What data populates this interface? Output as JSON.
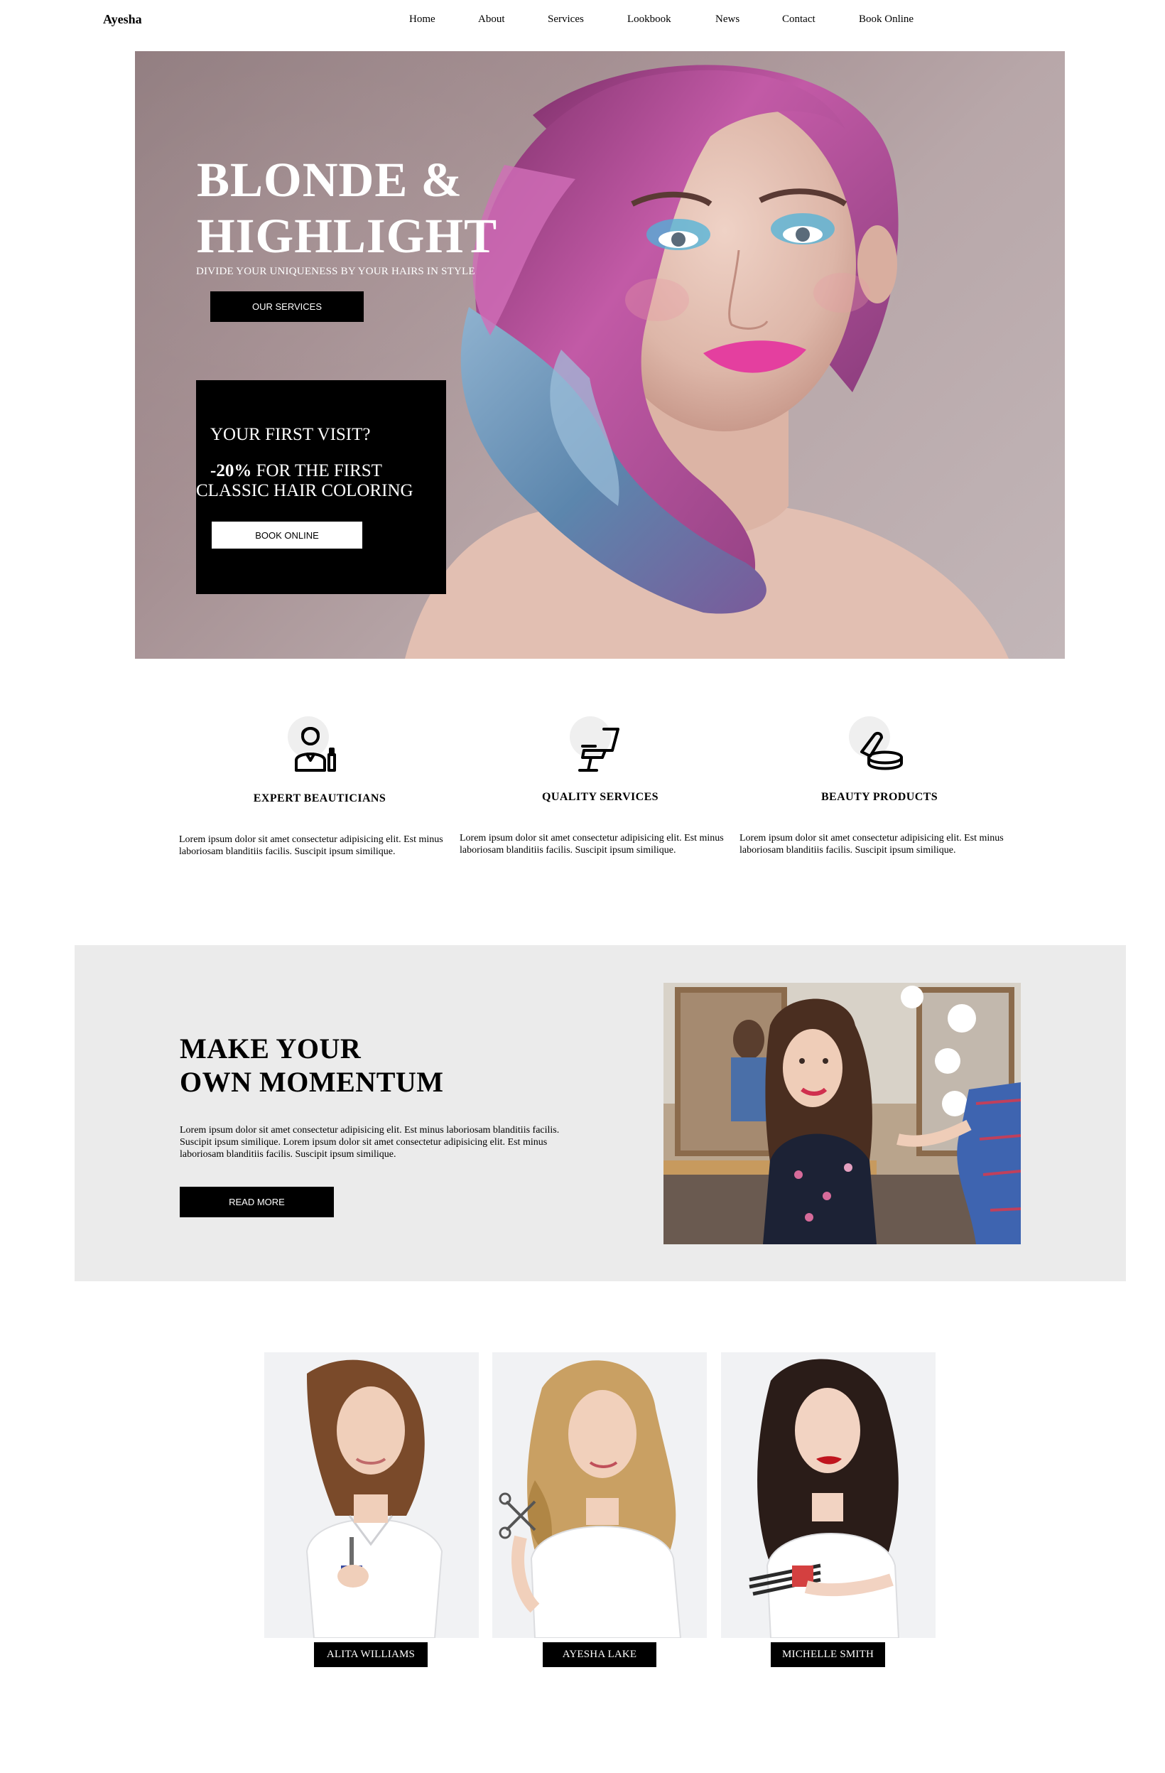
{
  "header": {
    "logo": "Ayesha",
    "nav": [
      "Home",
      "About",
      "Services",
      "Lookbook",
      "News",
      "Contact",
      "Book Online"
    ]
  },
  "hero": {
    "title_line1": "BLONDE &",
    "title_line2": "HIGHLIGHT",
    "subtitle": "DIVIDE YOUR UNIQUENESS BY YOUR HAIRS IN STYLE",
    "cta": "OUR SERVICES",
    "promo": {
      "question": "YOUR FIRST VISIT?",
      "discount": "-20%",
      "line1_rest": " FOR THE FIRST",
      "line2": "CLASSIC HAIR COLORING",
      "cta": "BOOK ONLINE"
    }
  },
  "features": [
    {
      "icon": "beautician-icon",
      "title": "EXPERT BEAUTICIANS",
      "text": "Lorem ipsum dolor sit amet consectetur adipisicing elit. Est minus laboriosam blanditiis facilis. Suscipit ipsum similique."
    },
    {
      "icon": "salon-chair-icon",
      "title": "QUALITY SERVICES",
      "text": "Lorem ipsum dolor sit amet consectetur adipisicing elit. Est minus laboriosam blanditiis facilis. Suscipit ipsum similique."
    },
    {
      "icon": "beauty-products-icon",
      "title": "BEAUTY PRODUCTS",
      "text": "Lorem ipsum dolor sit amet consectetur adipisicing elit. Est minus laboriosam blanditiis facilis. Suscipit ipsum similique."
    }
  ],
  "momentum": {
    "title_line1": "MAKE YOUR",
    "title_line2": "OWN MOMENTUM",
    "text": "Lorem ipsum dolor sit amet consectetur adipisicing elit. Est minus laboriosam blanditiis facilis. Suscipit ipsum similique. Lorem ipsum dolor sit amet consectetur adipisicing elit. Est minus laboriosam blanditiis facilis. Suscipit ipsum similique.",
    "cta": "READ MORE"
  },
  "team": [
    {
      "name": "ALITA WILLIAMS",
      "hair": "#7a4a2a"
    },
    {
      "name": "AYESHA LAKE",
      "hair": "#c9a063"
    },
    {
      "name": "MICHELLE SMITH",
      "hair": "#2a1c18"
    }
  ],
  "colors": {
    "accent": "#000000",
    "panel_bg": "#ebebeb",
    "hero_bg": "#a28c8f",
    "hair_pink": "#b54c9c",
    "hair_blue": "#5f8fb8"
  }
}
